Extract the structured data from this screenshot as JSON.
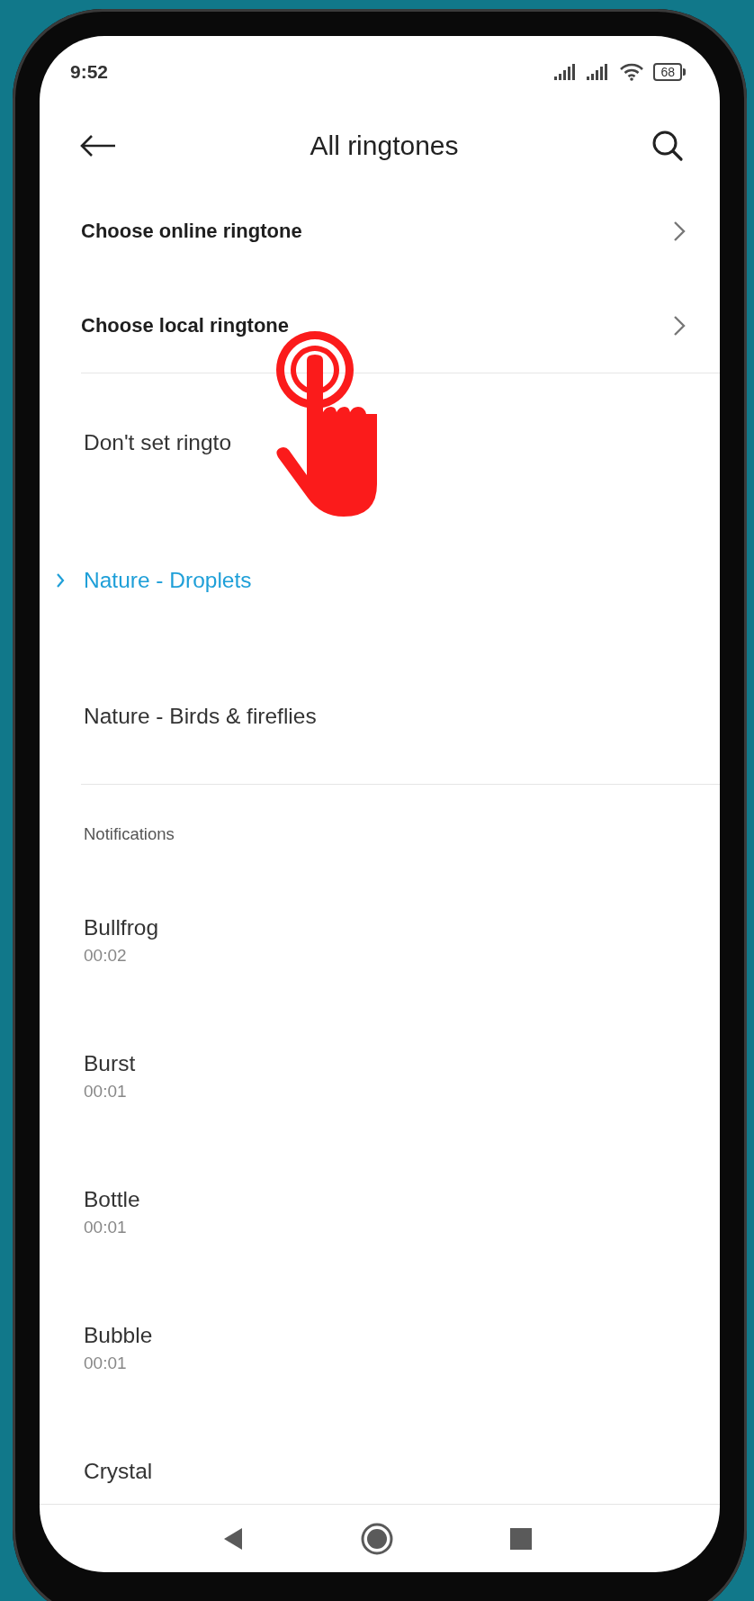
{
  "status_bar": {
    "time": "9:52",
    "battery": "68"
  },
  "header": {
    "title": "All ringtones"
  },
  "options": [
    {
      "label": "Choose online ringtone",
      "kind": "link"
    },
    {
      "label": "Choose local ringtone",
      "kind": "link"
    }
  ],
  "ringtones": [
    {
      "label": "Don't set ringto",
      "selected": false
    },
    {
      "label": "Nature - Droplets",
      "selected": true
    },
    {
      "label": "Nature - Birds & fireflies",
      "selected": false
    }
  ],
  "notifications": {
    "title": "Notifications",
    "items": [
      {
        "name": "Bullfrog",
        "duration": "00:02"
      },
      {
        "name": "Burst",
        "duration": "00:01"
      },
      {
        "name": "Bottle",
        "duration": "00:01"
      },
      {
        "name": "Bubble",
        "duration": "00:01"
      },
      {
        "name": "Crystal"
      }
    ]
  }
}
